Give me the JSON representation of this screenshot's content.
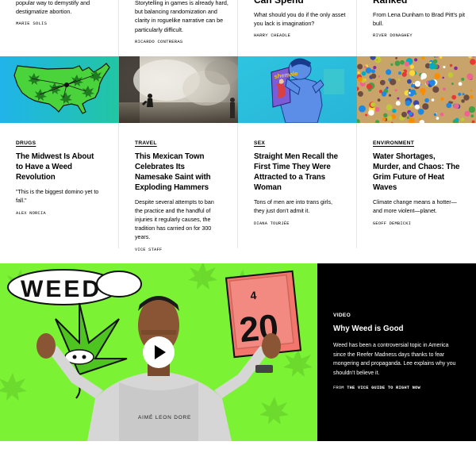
{
  "top_row": [
    {
      "title": "",
      "dek": "popular way to demystify and destigmatize abortion.",
      "byline": "MARIE SOLIS"
    },
    {
      "title": "",
      "dek": "Storytelling in games is already hard, but balancing randomization and clarity in roguelike narrative can be particularly difficult.",
      "byline": "RICARDO CONTRERAS"
    },
    {
      "title": "Can Spend",
      "dek": "What should you do if the only asset you lack is imagination?",
      "byline": "HARRY CHEADLE"
    },
    {
      "title": "Ranked",
      "dek": "From Lena Dunham to Brad Pitt's pit bull.",
      "byline": "RIVER DONAGHEY"
    }
  ],
  "articles": [
    {
      "category": "DRUGS",
      "title": "The Midwest Is About to Have a Weed Revolution",
      "dek": "\"This is the biggest domino yet to fall.\"",
      "byline": "ALEX NORCIA",
      "image": "us-map-weed-illustration"
    },
    {
      "category": "TRAVEL",
      "title": "This Mexican Town Celebrates Its Namesake Saint with Exploding Hammers",
      "dek": "Despite several attempts to ban the practice and the handful of injuries it regularly causes, the tradition has carried on for 300 years.",
      "byline": "VICE STAFF",
      "image": "exploding-hammer-smoke-photo"
    },
    {
      "category": "SEX",
      "title": "Straight Men Recall the First Time They Were Attracted to a Trans Woman",
      "dek": "Tons of men are into trans girls, they just don't admit it.",
      "byline": "DIANA TOURJÉE",
      "image": "magazine-reader-illustration",
      "image_text": "shemale"
    },
    {
      "category": "ENVIRONMENT",
      "title": "Water Shortages, Murder, and Chaos: The Grim Future of Heat Waves",
      "dek": "Climate change means a hotter—and more violent—planet.",
      "byline": "GEOFF DEMBICKI",
      "image": "crowded-beach-photo"
    }
  ],
  "video": {
    "category": "VIDEO",
    "title": "Why Weed is Good",
    "dek": "Weed has been a controversial topic in America since the Reefer Madness days thanks to fear mongering and propaganda. Lee explains why you shouldn't believe it.",
    "from_label": "FROM",
    "from_show": "THE VICE GUIDE TO RIGHT NOW",
    "thumbnail_text_weed": "WEED",
    "thumbnail_text_4": "4",
    "thumbnail_text_20": "20",
    "sweater_text": "AIMÉ LEON DORE",
    "play_icon": "play-icon"
  },
  "colors": {
    "video_green": "#7bf233",
    "video_panel": "#000000",
    "map_green": "#4bd33b",
    "map_bg_start": "#1fb6e8",
    "map_bg_end": "#22c7a6"
  }
}
